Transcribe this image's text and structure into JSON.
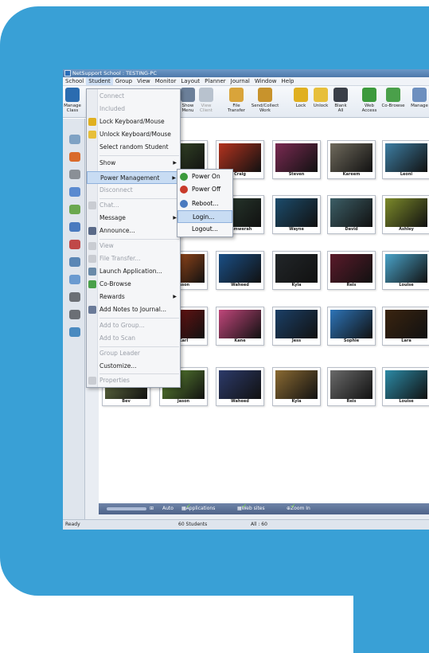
{
  "window": {
    "title": "NetSupport School : TESTING-PC"
  },
  "menubar": [
    "School",
    "Student",
    "Group",
    "View",
    "Monitor",
    "Layout",
    "Planner",
    "Journal",
    "Window",
    "Help"
  ],
  "toolbar": [
    {
      "label": "Manage Class",
      "icon": "manage-class-icon"
    },
    {
      "label": "Show Menu",
      "icon": "show-icon"
    },
    {
      "label": "View Client",
      "icon": "view-client-icon"
    },
    {
      "label": "File Transfer",
      "icon": "file-transfer-icon"
    },
    {
      "label": "Send/Collect Work",
      "icon": "send-collect-icon"
    },
    {
      "label": "Lock",
      "icon": "lock-icon"
    },
    {
      "label": "Unlock",
      "icon": "unlock-icon"
    },
    {
      "label": "Blank All",
      "icon": "blank-all-icon"
    },
    {
      "label": "Web Access",
      "icon": "web-access-icon"
    },
    {
      "label": "Co-Browse",
      "icon": "co-browse-icon"
    },
    {
      "label": "Manage",
      "icon": "manage-icon"
    }
  ],
  "student_menu": {
    "items": [
      {
        "label": "Connect",
        "disabled": true
      },
      {
        "label": "Included",
        "disabled": true
      },
      {
        "label": "Lock Keyboard/Mouse",
        "disabled": false
      },
      {
        "label": "Unlock Keyboard/Mouse",
        "disabled": false
      },
      {
        "label": "Select random Student",
        "disabled": false
      },
      {
        "label": "Show",
        "disabled": false
      },
      {
        "label": "Power Management",
        "disabled": false
      },
      {
        "label": "Disconnect",
        "disabled": true
      },
      {
        "label": "Chat...",
        "disabled": true
      },
      {
        "label": "Message",
        "disabled": false
      },
      {
        "label": "Announce...",
        "disabled": false
      },
      {
        "label": "View",
        "disabled": true
      },
      {
        "label": "File Transfer...",
        "disabled": true
      },
      {
        "label": "Launch Application...",
        "disabled": false
      },
      {
        "label": "Co-Browse",
        "disabled": false
      },
      {
        "label": "Rewards",
        "disabled": false
      },
      {
        "label": "Add Notes to Journal...",
        "disabled": false
      },
      {
        "label": "Add to Group...",
        "disabled": true
      },
      {
        "label": "Add to Scan",
        "disabled": true
      },
      {
        "label": "Group Leader",
        "disabled": true
      },
      {
        "label": "Customize...",
        "disabled": false
      },
      {
        "label": "Properties",
        "disabled": true
      }
    ]
  },
  "power_submenu": {
    "items": [
      {
        "label": "Power On"
      },
      {
        "label": "Power Off"
      },
      {
        "label": "Reboot..."
      },
      {
        "label": "Login..."
      },
      {
        "label": "Logout..."
      }
    ]
  },
  "students": [
    {
      "name": "",
      "color": "#3a4f2a"
    },
    {
      "name": "Craig",
      "color": "#b3331f"
    },
    {
      "name": "Steven",
      "color": "#7a2a52"
    },
    {
      "name": "Kareem",
      "color": "#6f6a5c"
    },
    {
      "name": "Leoni",
      "color": "#3e7ea3"
    },
    {
      "name": "",
      "color": "#4b5a3a"
    },
    {
      "name": "Samwerah",
      "color": "#2a3c30"
    },
    {
      "name": "Wayne",
      "color": "#1c4c6c"
    },
    {
      "name": "David",
      "color": "#3c5e66"
    },
    {
      "name": "Ashley",
      "color": "#7c8a2a"
    },
    {
      "name": "Jason",
      "color": "#b5531c"
    },
    {
      "name": "Waheed",
      "color": "#1a4f86"
    },
    {
      "name": "Kyla",
      "color": "#222629"
    },
    {
      "name": "Reis",
      "color": "#5a1a2a"
    },
    {
      "name": "Louise",
      "color": "#4aa3c9"
    },
    {
      "name": "Karl",
      "color": "#7a1212"
    },
    {
      "name": "Kane",
      "color": "#c0467a"
    },
    {
      "name": "Jess",
      "color": "#1b3f66"
    },
    {
      "name": "Sophie",
      "color": "#2d74b8"
    },
    {
      "name": "Lara",
      "color": "#3a2410"
    },
    {
      "name": "Bev",
      "color": "#6c7a48"
    },
    {
      "name": "Jason",
      "color": "#5f8a34"
    },
    {
      "name": "Waheed",
      "color": "#2c3a6a"
    },
    {
      "name": "Kyla",
      "color": "#8a6a32"
    },
    {
      "name": "Reis",
      "color": "#6a6a6a"
    },
    {
      "name": "Louise",
      "color": "#2c8aa6"
    }
  ],
  "bottombar": {
    "auto": "Auto",
    "applications": "Applications",
    "websites": "Web sites",
    "zoom": "Zoom In"
  },
  "statusbar": {
    "ready": "Ready",
    "students": "60 Students",
    "all": "All : 60"
  },
  "colors": {
    "bezel": "#39a0d6"
  }
}
